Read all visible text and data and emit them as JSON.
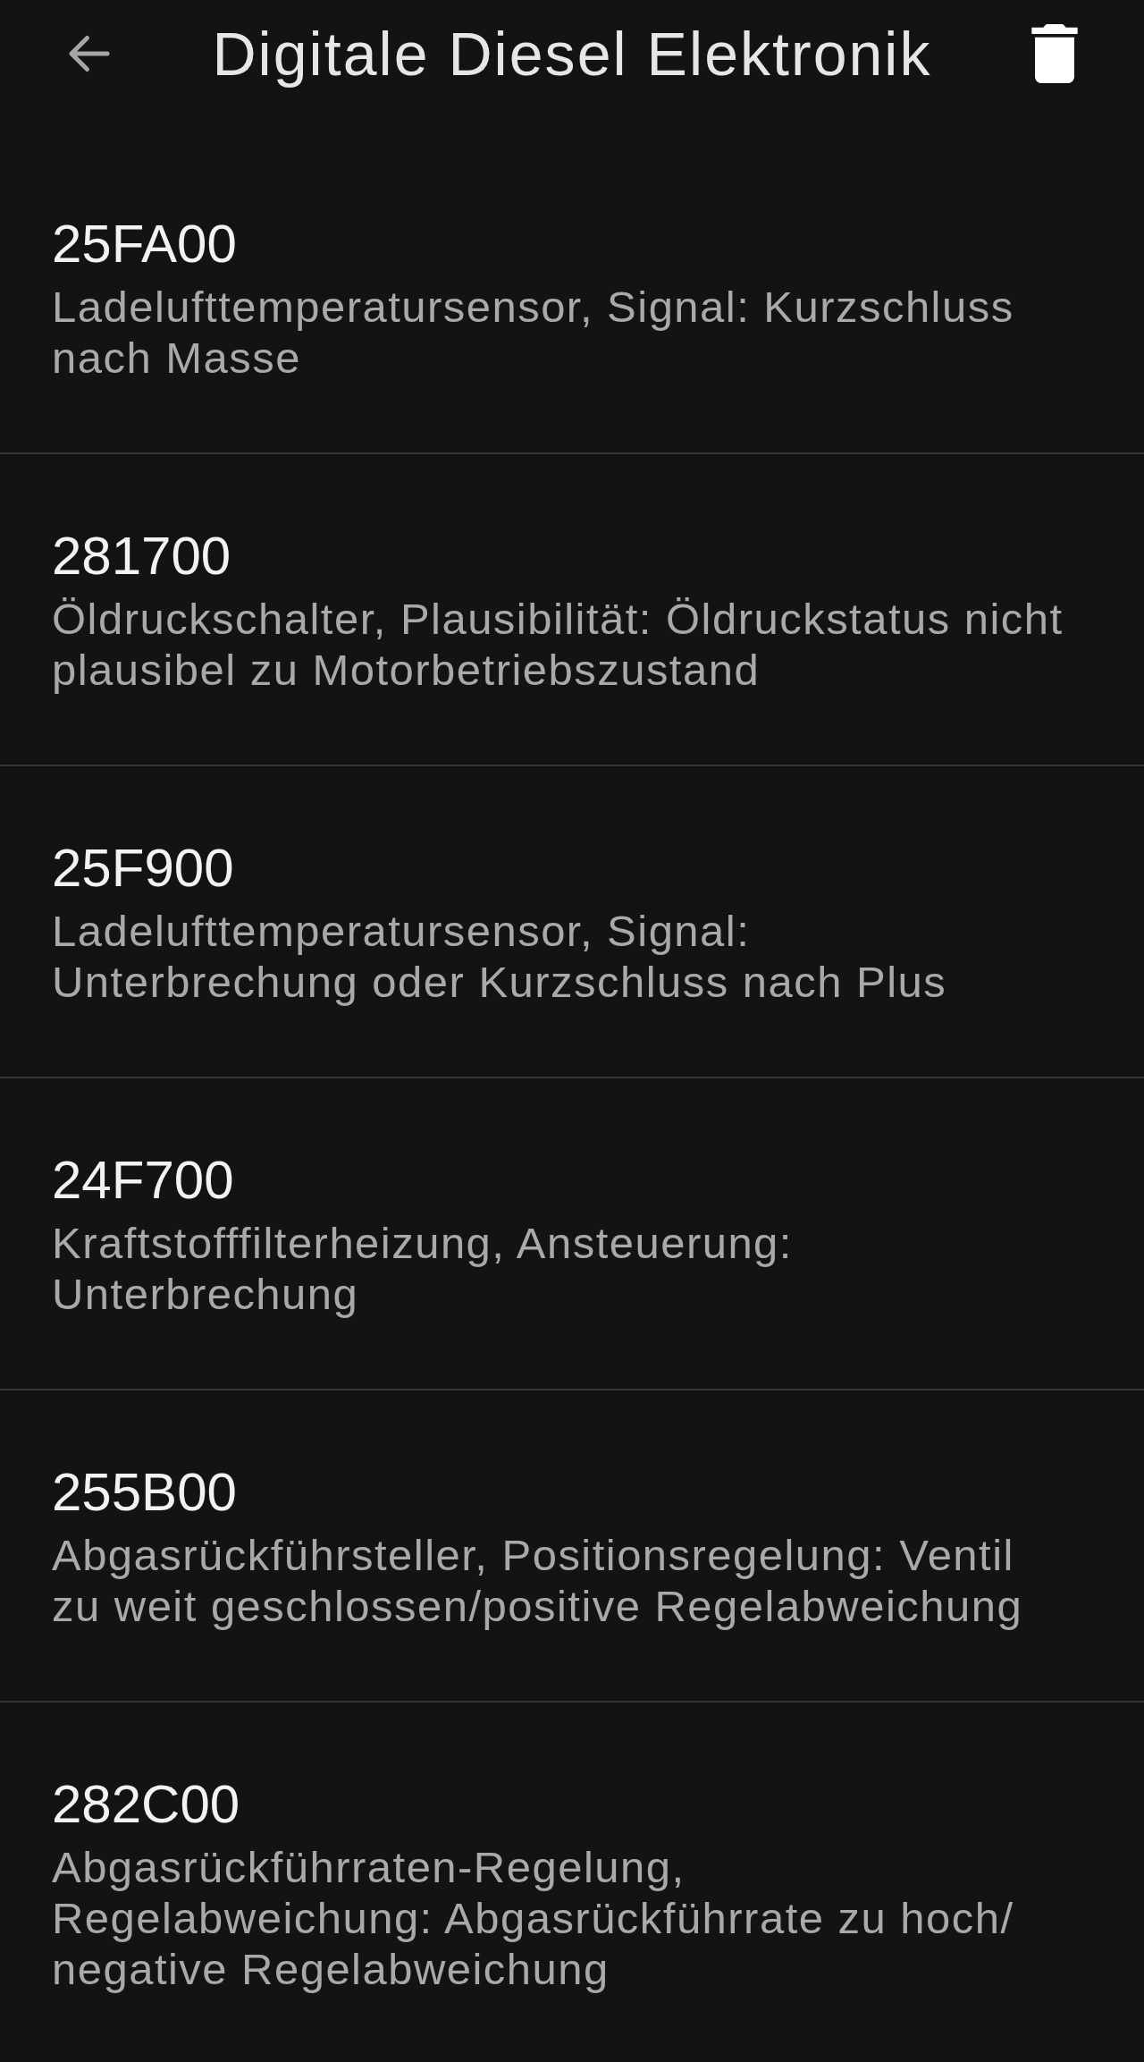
{
  "header": {
    "title": "Digitale Diesel Elektronik"
  },
  "faults": [
    {
      "code": "25FA00",
      "description": "Ladelufttemperatursensor, Signal: Kurzschluss\nnach Masse"
    },
    {
      "code": "281700",
      "description": "Öldruckschalter, Plausibilität: Öldruckstatus nicht\nplausibel zu Motorbetriebszustand"
    },
    {
      "code": "25F900",
      "description": "Ladelufttemperatursensor, Signal:\nUnterbrechung oder Kurzschluss nach Plus"
    },
    {
      "code": "24F700",
      "description": "Kraftstofffilterheizung, Ansteuerung:\nUnterbrechung"
    },
    {
      "code": "255B00",
      "description": "Abgasrückführsteller, Positionsregelung: Ventil\nzu weit geschlossen/positive Regelabweichung"
    },
    {
      "code": "282C00",
      "description": "Abgasrückführraten-Regelung,\nRegelabweichung: Abgasrückführrate zu hoch/\nnegative Regelabweichung"
    }
  ]
}
